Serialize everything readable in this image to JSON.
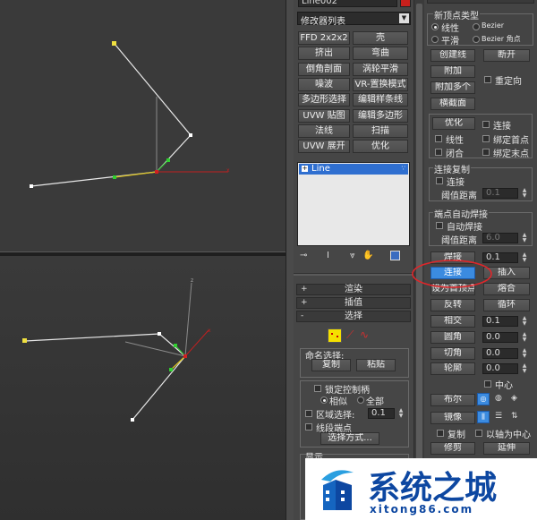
{
  "object_name": "Line002",
  "modifier_list_label": "修改器列表",
  "modifier_buttons": [
    [
      "FFD 2x2x2",
      "壳"
    ],
    [
      "挤出",
      "弯曲"
    ],
    [
      "倒角剖面",
      "涡轮平滑"
    ],
    [
      "噪波",
      "VR-置换模式"
    ],
    [
      "多边形选择",
      "编辑样条线"
    ],
    [
      "UVW 贴图",
      "编辑多边形"
    ],
    [
      "法线",
      "扫描"
    ],
    [
      "UVW 展开",
      "优化"
    ]
  ],
  "stack_item": "Line",
  "rollouts": {
    "render": "渲染",
    "interpolation": "插值",
    "selection": "选择"
  },
  "named_selection": {
    "label": "命名选择:",
    "copy": "复制",
    "paste": "粘贴"
  },
  "selection_options": {
    "lock_handles": "锁定控制柄",
    "similar": "相似",
    "all": "全部",
    "area_select": "区域选择:",
    "area_value": "0.1",
    "segment_end": "线段端点",
    "select_by": "选择方式..."
  },
  "display_label": "显示",
  "new_vertex_type": {
    "title": "新顶点类型",
    "linear": "线性",
    "bezier": "Bezier",
    "smooth": "平滑",
    "bezier_corner": "Bezier 角点"
  },
  "geometry_buttons": {
    "create_line": "创建线",
    "break": "断开",
    "attach": "附加",
    "attach_multi": "附加多个",
    "reorient": "重定向",
    "cross_section": "横截面",
    "refine": "优化",
    "connect": "连接",
    "linear": "线性",
    "bind_first": "绑定首点",
    "closed": "闭合",
    "bind_last": "绑定末点"
  },
  "connect_copy": {
    "title": "连接复制",
    "connect": "连接",
    "threshold": "阈值距离",
    "value": "0.1"
  },
  "endpoint_weld": {
    "title": "端点自动焊接",
    "auto_weld": "自动焊接",
    "threshold": "阈值距离",
    "value": "6.0"
  },
  "vertex_ops": {
    "weld": "焊接",
    "weld_value": "0.1",
    "connect": "连接",
    "insert": "插入",
    "make_first": "设为首顶点",
    "fuse": "熔合",
    "reverse": "反转",
    "cycle": "循环",
    "crossinsert": "相交",
    "crossinsert_value": "0.1",
    "fillet": "圆角",
    "fillet_value": "0.0",
    "chamfer": "切角",
    "chamfer_value": "0.0",
    "outline": "轮廓",
    "outline_value": "0.0",
    "center": "中心",
    "boolean": "布尔",
    "mirror": "镜像",
    "copy": "复制",
    "about_pivot": "以轴为中心",
    "trim": "修剪",
    "extend": "延伸"
  },
  "watermark": {
    "title": "系统之城",
    "url": "xitong86.com"
  },
  "colors": {
    "object_color": "#c8201c",
    "selected_button": "#3b8be0",
    "annotation_red": "#e0262a",
    "spline": "#e8e8e8",
    "vertex_yellow": "#f0e040",
    "vertex_green": "#30d030"
  }
}
